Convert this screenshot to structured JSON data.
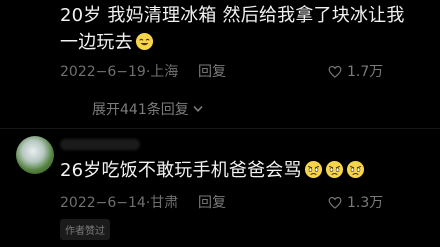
{
  "comment1": {
    "line1": "20岁 我妈清理冰箱 然后给我拿了块冰让我",
    "line2": "一边玩去",
    "date": "2022−6−19",
    "location": "上海",
    "reply_label": "回复",
    "likes": "1.7万",
    "emoji": "smiling-face-icon"
  },
  "expand_replies": {
    "label": "展开441条回复"
  },
  "comment2": {
    "text": "26岁吃饭不敢玩手机爸爸会骂",
    "date": "2022−6−14",
    "location": "甘肃",
    "reply_label": "回复",
    "likes": "1.3万",
    "emojis": [
      "crying-face-icon",
      "crying-face-icon",
      "crying-face-icon"
    ],
    "badge": "作者赞过"
  },
  "colors": {
    "background": "#000000",
    "text": "#f2f2f2",
    "meta": "#6f6f6f"
  }
}
